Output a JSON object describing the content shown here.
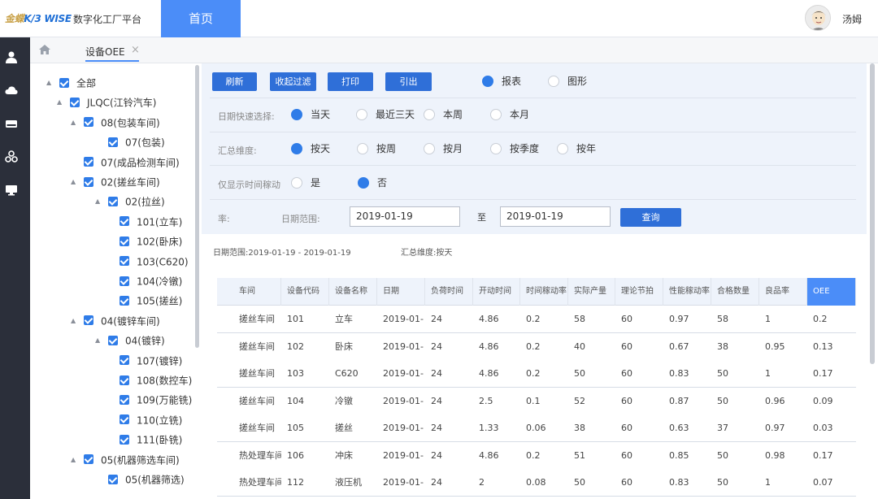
{
  "header": {
    "brand_prefix": "金蝶",
    "brand_product": "K/3 WISE",
    "platform": "数字化工厂平台",
    "home_tab": "首页",
    "username": "汤姆"
  },
  "rail_icons": [
    "user-icon",
    "cloud-icon",
    "storage-icon",
    "network-icon",
    "monitor-icon"
  ],
  "tabs": {
    "active": "设备OEE",
    "close": "×"
  },
  "tree": [
    {
      "label": "全部",
      "level": 0,
      "caret": true
    },
    {
      "label": "JLQC(江铃汽车)",
      "level": 1,
      "caret": true
    },
    {
      "label": "08(包装车间)",
      "level": 2,
      "caret": true
    },
    {
      "label": "07(包装)",
      "level": 3,
      "caret": false
    },
    {
      "label": "07(成品检测车间)",
      "level": 2,
      "caret": false
    },
    {
      "label": "02(搓丝车间)",
      "level": 2,
      "caret": true
    },
    {
      "label": "02(拉丝)",
      "level": 3,
      "caret": true
    },
    {
      "label": "101(立车)",
      "level": 4,
      "caret": false
    },
    {
      "label": "102(卧床)",
      "level": 4,
      "caret": false
    },
    {
      "label": "103(C620)",
      "level": 4,
      "caret": false
    },
    {
      "label": "104(冷镦)",
      "level": 4,
      "caret": false
    },
    {
      "label": "105(搓丝)",
      "level": 4,
      "caret": false
    },
    {
      "label": "04(镀锌车间)",
      "level": 2,
      "caret": true
    },
    {
      "label": "04(镀锌)",
      "level": 3,
      "caret": true
    },
    {
      "label": "107(镀锌)",
      "level": 4,
      "caret": false
    },
    {
      "label": "108(数控车)",
      "level": 4,
      "caret": false
    },
    {
      "label": "109(万能铣)",
      "level": 4,
      "caret": false
    },
    {
      "label": "110(立铣)",
      "level": 4,
      "caret": false
    },
    {
      "label": "111(卧铣)",
      "level": 4,
      "caret": false
    },
    {
      "label": "05(机器筛选车间)",
      "level": 2,
      "caret": true
    },
    {
      "label": "05(机器筛选)",
      "level": 3,
      "caret": false
    }
  ],
  "toolbar": {
    "refresh": "刷新",
    "collapse_filter": "收起过滤",
    "print": "打印",
    "export": "引出",
    "view_report": "报表",
    "view_chart": "图形",
    "view_selected": "报表"
  },
  "filters": {
    "quick_date_label": "日期快速选择:",
    "quick_date_options": [
      "当天",
      "最近三天",
      "本周",
      "本月"
    ],
    "quick_date_selected": "当天",
    "summary_dim_label": "汇总维度:",
    "summary_dim_options": [
      "按天",
      "按周",
      "按月",
      "按季度",
      "按年"
    ],
    "summary_dim_selected": "按天",
    "util_only_label": "仅显示时间稼动",
    "util_only_options": [
      "是",
      "否"
    ],
    "util_only_selected": "否",
    "rate_label": "率:",
    "date_range_label": "日期范围:",
    "date_from": "2019-01-19",
    "date_to_label": "至",
    "date_to": "2019-01-19",
    "query": "查询"
  },
  "summary": {
    "date_range": "日期范围:2019-01-19 - 2019-01-19",
    "dimension": "汇总维度:按天"
  },
  "table": {
    "columns": [
      "车间",
      "设备代码",
      "设备名称",
      "日期",
      "负荷时间",
      "开动时间",
      "时间稼动率",
      "实际产量",
      "理论节拍",
      "性能稼动率",
      "合格数量",
      "良品率",
      "OEE"
    ],
    "rows": [
      [
        "搓丝车间",
        "101",
        "立车",
        "2019-01-",
        "24",
        "4.86",
        "0.2",
        "58",
        "60",
        "0.97",
        "58",
        "1",
        "0.2"
      ],
      [
        "搓丝车间",
        "102",
        "卧床",
        "2019-01-",
        "24",
        "4.86",
        "0.2",
        "40",
        "60",
        "0.67",
        "38",
        "0.95",
        "0.13"
      ],
      [
        "搓丝车间",
        "103",
        "C620",
        "2019-01-",
        "24",
        "4.86",
        "0.2",
        "50",
        "60",
        "0.83",
        "50",
        "1",
        "0.17"
      ],
      [
        "搓丝车间",
        "104",
        "冷镦",
        "2019-01-",
        "24",
        "2.5",
        "0.1",
        "52",
        "60",
        "0.87",
        "50",
        "0.96",
        "0.09"
      ],
      [
        "搓丝车间",
        "105",
        "搓丝",
        "2019-01-",
        "24",
        "1.33",
        "0.06",
        "38",
        "60",
        "0.63",
        "37",
        "0.97",
        "0.03"
      ],
      [
        "热处理车间",
        "106",
        "冲床",
        "2019-01-",
        "24",
        "4.86",
        "0.2",
        "51",
        "60",
        "0.85",
        "50",
        "0.98",
        "0.17"
      ],
      [
        "热处理车间",
        "112",
        "液压机",
        "2019-01-",
        "24",
        "2",
        "0.08",
        "50",
        "60",
        "0.83",
        "50",
        "1",
        "0.07"
      ]
    ]
  },
  "colors": {
    "accent": "#4b8df8",
    "button": "#2f6fd8",
    "rail": "#2b2f3a",
    "toolbar_bg": "#eef3fb"
  }
}
